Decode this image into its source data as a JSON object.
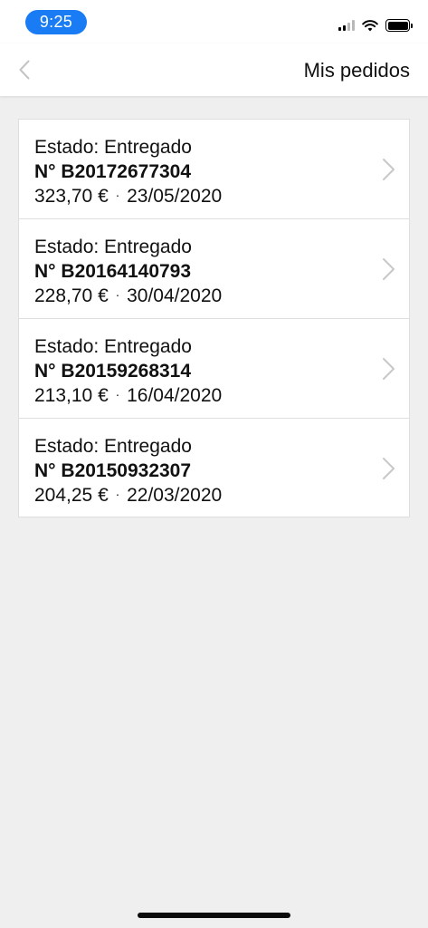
{
  "status_bar": {
    "time": "9:25"
  },
  "nav": {
    "title": "Mis pedidos"
  },
  "orders": [
    {
      "status": "Estado: Entregado",
      "number": "N° B20172677304",
      "amount": "323,70 €",
      "date": "23/05/2020"
    },
    {
      "status": "Estado: Entregado",
      "number": "N° B20164140793",
      "amount": "228,70 €",
      "date": "30/04/2020"
    },
    {
      "status": "Estado: Entregado",
      "number": "N° B20159268314",
      "amount": "213,10 €",
      "date": "16/04/2020"
    },
    {
      "status": "Estado: Entregado",
      "number": "N° B20150932307",
      "amount": "204,25 €",
      "date": "22/03/2020"
    }
  ],
  "separator": "·",
  "icons": {
    "back": "chevron-left-icon",
    "row": "chevron-right-icon"
  },
  "colors": {
    "time_pill": "#1a7cf5",
    "background": "#efefef"
  }
}
